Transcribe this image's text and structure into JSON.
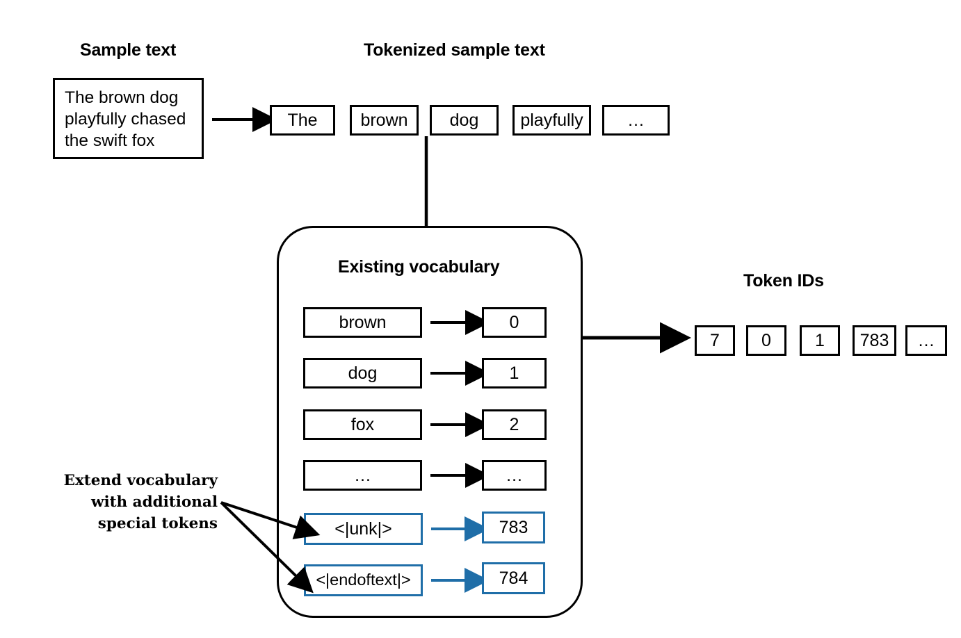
{
  "colors": {
    "ink": "#000000",
    "accent_blue": "#1f6ea8",
    "background": "#ffffff"
  },
  "headings": {
    "sample_text": "Sample text",
    "tokenized_sample_text": "Tokenized sample text",
    "existing_vocabulary": "Existing vocabulary",
    "token_ids": "Token IDs"
  },
  "sample_text": {
    "lines": [
      "The brown dog",
      "playfully chased",
      "the swift fox"
    ]
  },
  "tokens": [
    {
      "label": "The"
    },
    {
      "label": "brown"
    },
    {
      "label": "dog"
    },
    {
      "label": "playfully"
    },
    {
      "label": "…"
    }
  ],
  "vocabulary": [
    {
      "token": "brown",
      "id": "0",
      "special": false
    },
    {
      "token": "dog",
      "id": "1",
      "special": false
    },
    {
      "token": "fox",
      "id": "2",
      "special": false
    },
    {
      "token": "…",
      "id": "…",
      "special": false
    },
    {
      "token": "<|unk|>",
      "id": "783",
      "special": true
    },
    {
      "token": "<|endoftext|>",
      "id": "784",
      "special": true
    }
  ],
  "annotation": {
    "lines": [
      "Extend vocabulary",
      "with additional",
      "special tokens"
    ]
  },
  "token_ids": [
    {
      "value": "7"
    },
    {
      "value": "0"
    },
    {
      "value": "1"
    },
    {
      "value": "783"
    },
    {
      "value": "…"
    }
  ],
  "icons": {
    "arrow_right": "arrow-right-icon",
    "connector_line": "connector-line-icon",
    "pointer_arrow": "pointer-arrow-icon"
  }
}
